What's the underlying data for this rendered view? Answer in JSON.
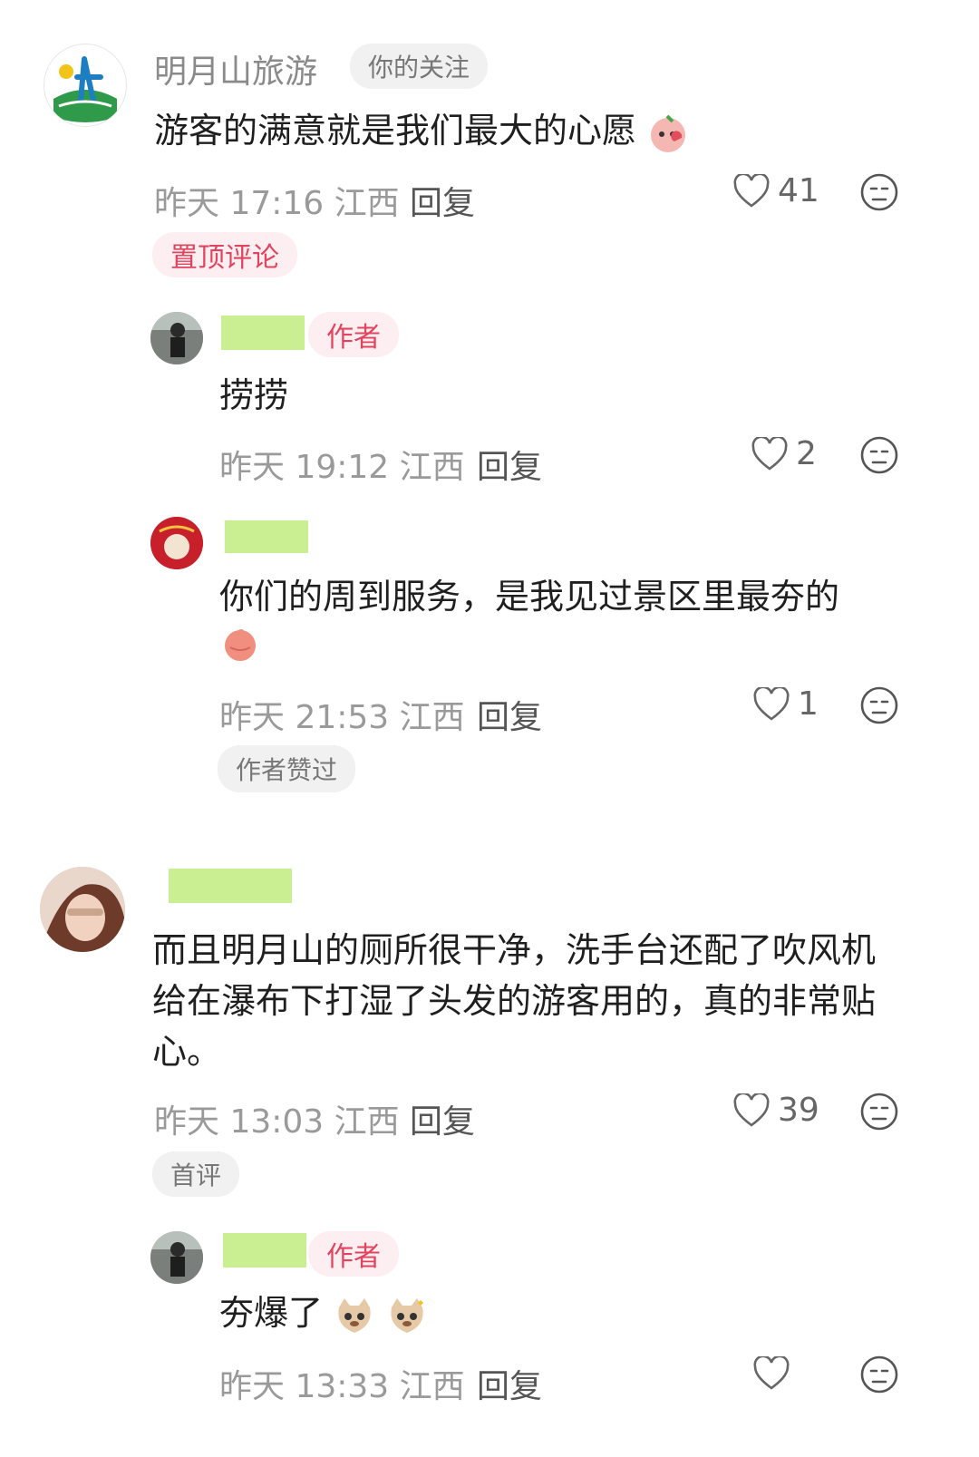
{
  "comments": [
    {
      "user": "明月山旅游",
      "follow_badge": "你的关注",
      "text": "游客的满意就是我们最大的心愿",
      "time": "昨天 17:16 江西",
      "reply": "回复",
      "likes": "41",
      "tag": "置顶评论"
    },
    {
      "author_badge": "作者",
      "text": "捞捞",
      "time": "昨天 19:12 江西",
      "reply": "回复",
      "likes": "2"
    },
    {
      "text": "你们的周到服务，是我见过景区里最夯的",
      "time": "昨天 21:53 江西",
      "reply": "回复",
      "likes": "1",
      "tag": "作者赞过"
    },
    {
      "text": "而且明月山的厕所很干净，洗手台还配了吹风机给在瀑布下打湿了头发的游客用的，真的非常贴心。",
      "time": "昨天 13:03 江西",
      "reply": "回复",
      "likes": "39",
      "tag": "首评"
    },
    {
      "author_badge": "作者",
      "text": "夯爆了",
      "time": "昨天 13:33 江西",
      "reply": "回复",
      "likes": ""
    }
  ],
  "colors": {
    "accent_pink": "#e0445e",
    "meta_gray": "#9a9a9a",
    "mask_green": "#c9ef92"
  },
  "icons": [
    "heart-icon",
    "dislike-face-icon"
  ]
}
